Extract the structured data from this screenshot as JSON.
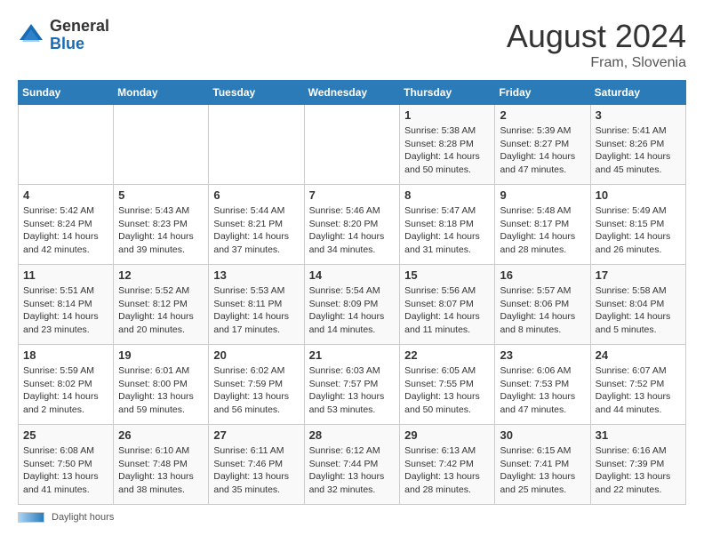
{
  "header": {
    "logo_general": "General",
    "logo_blue": "Blue",
    "title": "August 2024",
    "subtitle": "Fram, Slovenia"
  },
  "days_of_week": [
    "Sunday",
    "Monday",
    "Tuesday",
    "Wednesday",
    "Thursday",
    "Friday",
    "Saturday"
  ],
  "weeks": [
    [
      {
        "num": "",
        "sunrise": "",
        "sunset": "",
        "daylight": ""
      },
      {
        "num": "",
        "sunrise": "",
        "sunset": "",
        "daylight": ""
      },
      {
        "num": "",
        "sunrise": "",
        "sunset": "",
        "daylight": ""
      },
      {
        "num": "",
        "sunrise": "",
        "sunset": "",
        "daylight": ""
      },
      {
        "num": "1",
        "sunrise": "5:38 AM",
        "sunset": "8:28 PM",
        "daylight": "14 hours and 50 minutes."
      },
      {
        "num": "2",
        "sunrise": "5:39 AM",
        "sunset": "8:27 PM",
        "daylight": "14 hours and 47 minutes."
      },
      {
        "num": "3",
        "sunrise": "5:41 AM",
        "sunset": "8:26 PM",
        "daylight": "14 hours and 45 minutes."
      }
    ],
    [
      {
        "num": "4",
        "sunrise": "5:42 AM",
        "sunset": "8:24 PM",
        "daylight": "14 hours and 42 minutes."
      },
      {
        "num": "5",
        "sunrise": "5:43 AM",
        "sunset": "8:23 PM",
        "daylight": "14 hours and 39 minutes."
      },
      {
        "num": "6",
        "sunrise": "5:44 AM",
        "sunset": "8:21 PM",
        "daylight": "14 hours and 37 minutes."
      },
      {
        "num": "7",
        "sunrise": "5:46 AM",
        "sunset": "8:20 PM",
        "daylight": "14 hours and 34 minutes."
      },
      {
        "num": "8",
        "sunrise": "5:47 AM",
        "sunset": "8:18 PM",
        "daylight": "14 hours and 31 minutes."
      },
      {
        "num": "9",
        "sunrise": "5:48 AM",
        "sunset": "8:17 PM",
        "daylight": "14 hours and 28 minutes."
      },
      {
        "num": "10",
        "sunrise": "5:49 AM",
        "sunset": "8:15 PM",
        "daylight": "14 hours and 26 minutes."
      }
    ],
    [
      {
        "num": "11",
        "sunrise": "5:51 AM",
        "sunset": "8:14 PM",
        "daylight": "14 hours and 23 minutes."
      },
      {
        "num": "12",
        "sunrise": "5:52 AM",
        "sunset": "8:12 PM",
        "daylight": "14 hours and 20 minutes."
      },
      {
        "num": "13",
        "sunrise": "5:53 AM",
        "sunset": "8:11 PM",
        "daylight": "14 hours and 17 minutes."
      },
      {
        "num": "14",
        "sunrise": "5:54 AM",
        "sunset": "8:09 PM",
        "daylight": "14 hours and 14 minutes."
      },
      {
        "num": "15",
        "sunrise": "5:56 AM",
        "sunset": "8:07 PM",
        "daylight": "14 hours and 11 minutes."
      },
      {
        "num": "16",
        "sunrise": "5:57 AM",
        "sunset": "8:06 PM",
        "daylight": "14 hours and 8 minutes."
      },
      {
        "num": "17",
        "sunrise": "5:58 AM",
        "sunset": "8:04 PM",
        "daylight": "14 hours and 5 minutes."
      }
    ],
    [
      {
        "num": "18",
        "sunrise": "5:59 AM",
        "sunset": "8:02 PM",
        "daylight": "14 hours and 2 minutes."
      },
      {
        "num": "19",
        "sunrise": "6:01 AM",
        "sunset": "8:00 PM",
        "daylight": "13 hours and 59 minutes."
      },
      {
        "num": "20",
        "sunrise": "6:02 AM",
        "sunset": "7:59 PM",
        "daylight": "13 hours and 56 minutes."
      },
      {
        "num": "21",
        "sunrise": "6:03 AM",
        "sunset": "7:57 PM",
        "daylight": "13 hours and 53 minutes."
      },
      {
        "num": "22",
        "sunrise": "6:05 AM",
        "sunset": "7:55 PM",
        "daylight": "13 hours and 50 minutes."
      },
      {
        "num": "23",
        "sunrise": "6:06 AM",
        "sunset": "7:53 PM",
        "daylight": "13 hours and 47 minutes."
      },
      {
        "num": "24",
        "sunrise": "6:07 AM",
        "sunset": "7:52 PM",
        "daylight": "13 hours and 44 minutes."
      }
    ],
    [
      {
        "num": "25",
        "sunrise": "6:08 AM",
        "sunset": "7:50 PM",
        "daylight": "13 hours and 41 minutes."
      },
      {
        "num": "26",
        "sunrise": "6:10 AM",
        "sunset": "7:48 PM",
        "daylight": "13 hours and 38 minutes."
      },
      {
        "num": "27",
        "sunrise": "6:11 AM",
        "sunset": "7:46 PM",
        "daylight": "13 hours and 35 minutes."
      },
      {
        "num": "28",
        "sunrise": "6:12 AM",
        "sunset": "7:44 PM",
        "daylight": "13 hours and 32 minutes."
      },
      {
        "num": "29",
        "sunrise": "6:13 AM",
        "sunset": "7:42 PM",
        "daylight": "13 hours and 28 minutes."
      },
      {
        "num": "30",
        "sunrise": "6:15 AM",
        "sunset": "7:41 PM",
        "daylight": "13 hours and 25 minutes."
      },
      {
        "num": "31",
        "sunrise": "6:16 AM",
        "sunset": "7:39 PM",
        "daylight": "13 hours and 22 minutes."
      }
    ]
  ],
  "legend": {
    "daylight_hours": "Daylight hours"
  }
}
